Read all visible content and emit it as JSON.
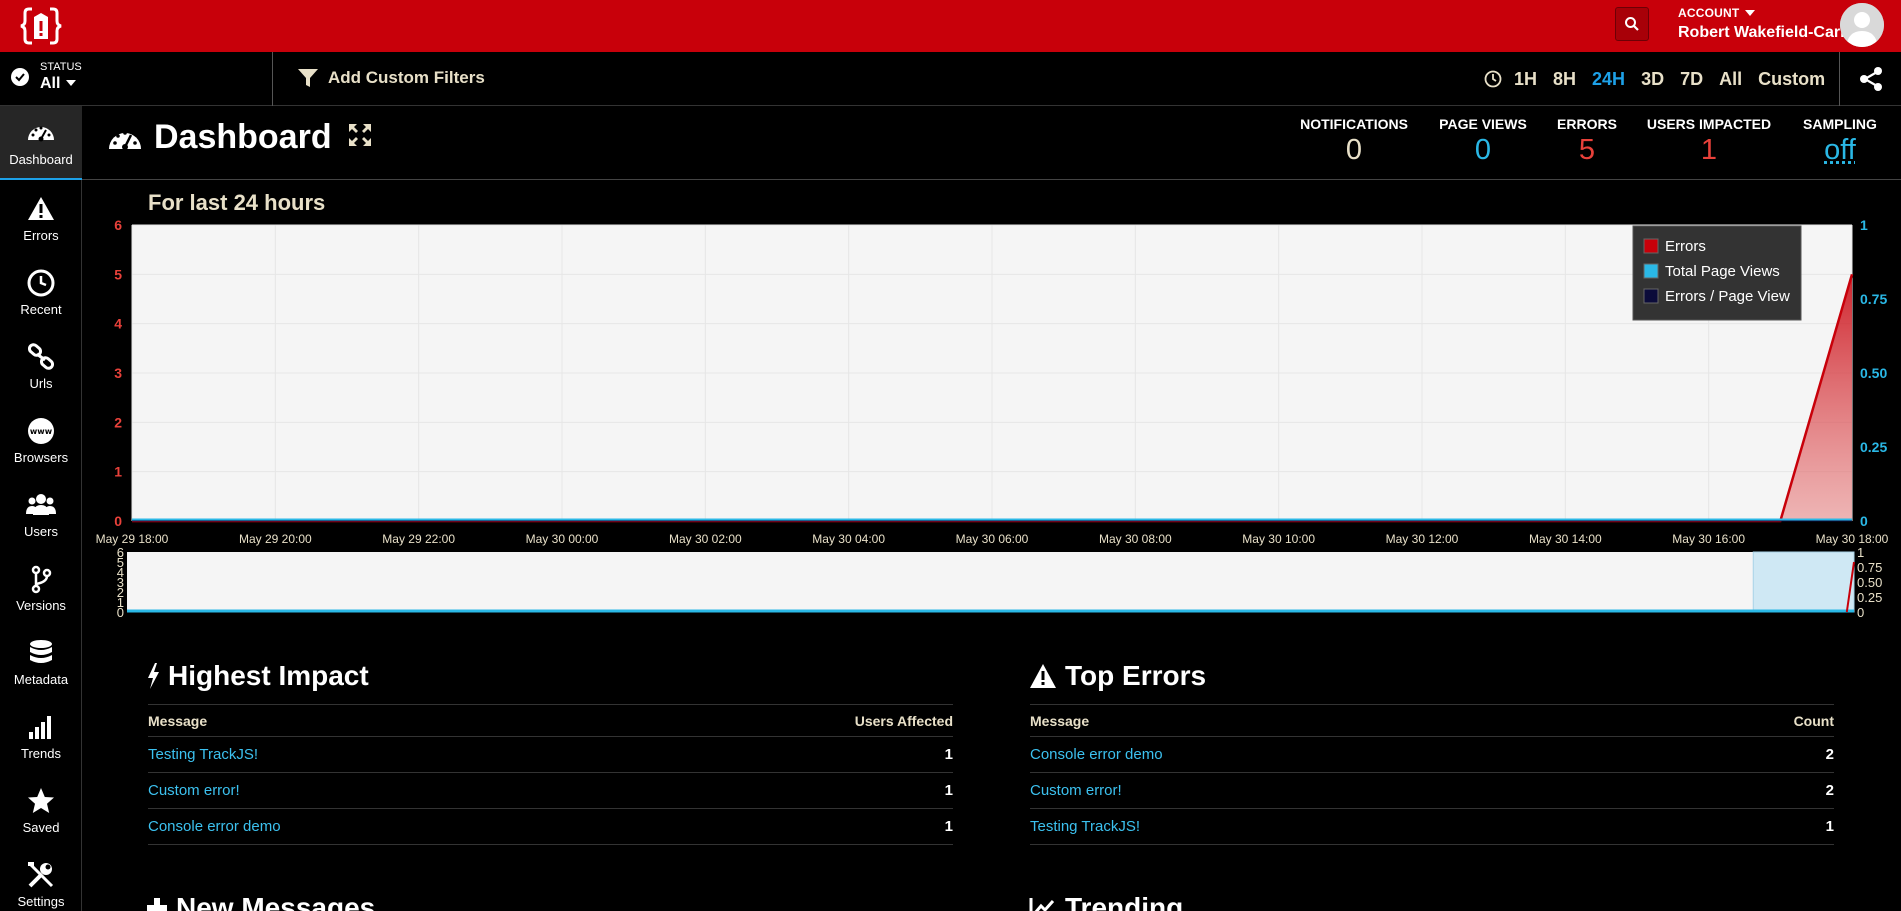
{
  "topbar": {
    "account_label": "ACCOUNT",
    "account_name": "Robert Wakefield-Carl"
  },
  "filterbar": {
    "status_label": "STATUS",
    "status_value": "All",
    "add_filters_label": "Add Custom Filters",
    "time_ranges": [
      "1H",
      "8H",
      "24H",
      "3D",
      "7D",
      "All",
      "Custom"
    ],
    "active_range": "24H"
  },
  "sidebar": {
    "items": [
      {
        "label": "Dashboard",
        "icon": "dashboard-icon"
      },
      {
        "label": "Errors",
        "icon": "warning-icon"
      },
      {
        "label": "Recent",
        "icon": "clock-icon"
      },
      {
        "label": "Urls",
        "icon": "link-icon"
      },
      {
        "label": "Browsers",
        "icon": "www-icon"
      },
      {
        "label": "Users",
        "icon": "users-icon"
      },
      {
        "label": "Versions",
        "icon": "branch-icon"
      },
      {
        "label": "Metadata",
        "icon": "database-icon"
      },
      {
        "label": "Trends",
        "icon": "bar-chart-icon"
      },
      {
        "label": "Saved",
        "icon": "star-icon"
      },
      {
        "label": "Settings",
        "icon": "tools-icon"
      }
    ]
  },
  "header": {
    "title": "Dashboard",
    "stats": [
      {
        "label": "NOTIFICATIONS",
        "value": "0",
        "color": "#e8e0c8"
      },
      {
        "label": "PAGE VIEWS",
        "value": "0",
        "color": "#2ab8e6"
      },
      {
        "label": "ERRORS",
        "value": "5",
        "color": "#e8413a"
      },
      {
        "label": "USERS IMPACTED",
        "value": "1",
        "color": "#e8413a"
      },
      {
        "label": "SAMPLING",
        "value": "off",
        "color": "#2ab8e6"
      }
    ]
  },
  "period_title": "For last 24 hours",
  "chart_data": {
    "type": "area",
    "x_tick_labels": [
      "May 29 18:00",
      "May 29 20:00",
      "May 29 22:00",
      "May 30 00:00",
      "May 30 02:00",
      "May 30 04:00",
      "May 30 06:00",
      "May 30 08:00",
      "May 30 10:00",
      "May 30 12:00",
      "May 30 14:00",
      "May 30 16:00",
      "May 30 18:00"
    ],
    "y_left_ticks": [
      "0",
      "1",
      "2",
      "3",
      "4",
      "5",
      "6"
    ],
    "y_left_lim": [
      0,
      6
    ],
    "y_right_ticks": [
      "0",
      "0.25",
      "0.50",
      "0.75",
      "1"
    ],
    "y_right_lim": [
      0,
      1
    ],
    "x_hours": [
      0,
      23.0,
      24
    ],
    "series": [
      {
        "name": "Errors",
        "color": "#c8000a",
        "x": [
          0,
          23.0,
          24
        ],
        "values": [
          0,
          0,
          5
        ]
      },
      {
        "name": "Total Page Views",
        "color": "#2ab8e6",
        "x": [
          0,
          24
        ],
        "values": [
          0,
          0
        ]
      },
      {
        "name": "Errors / Page View",
        "color": "#0b0b3a",
        "x": [
          0,
          24
        ],
        "values": [
          0,
          0
        ]
      }
    ],
    "legend_position": "top-right",
    "grid": true,
    "navigator": {
      "y_left_ticks": [
        "0",
        "1",
        "2",
        "3",
        "4",
        "5",
        "6"
      ],
      "y_right_ticks": [
        "0",
        "0.25",
        "0.50",
        "0.75",
        "1"
      ],
      "selection_start_hour": 22.6,
      "selection_end_hour": 24
    }
  },
  "highest_impact": {
    "title": "Highest Impact",
    "col_message": "Message",
    "col_value": "Users Affected",
    "rows": [
      {
        "message": "Testing TrackJS!",
        "value": "1"
      },
      {
        "message": "Custom error!",
        "value": "1"
      },
      {
        "message": "Console error demo",
        "value": "1"
      }
    ]
  },
  "top_errors": {
    "title": "Top Errors",
    "col_message": "Message",
    "col_value": "Count",
    "rows": [
      {
        "message": "Console error demo",
        "value": "2"
      },
      {
        "message": "Custom error!",
        "value": "2"
      },
      {
        "message": "Testing TrackJS!",
        "value": "1"
      }
    ]
  },
  "lower_sections": {
    "left_title": "New Messages",
    "right_title": "Trending"
  }
}
